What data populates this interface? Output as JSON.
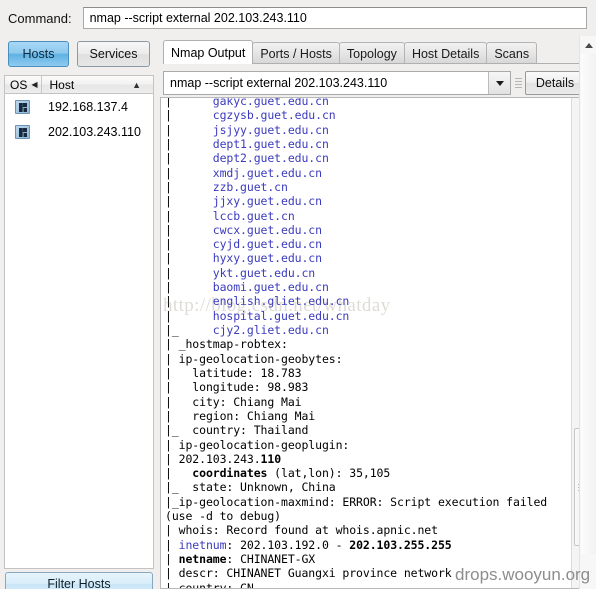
{
  "command_bar": {
    "label": "Command:",
    "value": "nmap --script external 202.103.243.110",
    "placeholder": "nmap"
  },
  "sidebar": {
    "buttons": [
      {
        "label": "Hosts",
        "active": true
      },
      {
        "label": "Services",
        "active": false
      }
    ],
    "column_headers": {
      "os": "OS",
      "host": "Host",
      "sort_indicator": "▲",
      "os_divider": "◀"
    },
    "hosts": [
      {
        "ip": "192.168.137.4",
        "os_icon": "windows-icon"
      },
      {
        "ip": "202.103.243.110",
        "os_icon": "windows-icon"
      }
    ],
    "filter_button": "Filter Hosts"
  },
  "tabs": [
    {
      "label": "Nmap Output",
      "active": true
    },
    {
      "label": "Ports / Hosts",
      "active": false
    },
    {
      "label": "Topology",
      "active": false
    },
    {
      "label": "Host Details",
      "active": false
    },
    {
      "label": "Scans",
      "active": false
    }
  ],
  "scan_selector": {
    "value": "nmap --script external 202.103.243.110",
    "dropdown_icon": "chevron-down-icon",
    "gripper_icon": "grip-icon"
  },
  "details_button": "Details",
  "output": {
    "lines": [
      [
        {
          "t": "|      ",
          "s": "plain"
        },
        {
          "t": "gakyc.guet.edu.cn",
          "s": "blue"
        }
      ],
      [
        {
          "t": "|      ",
          "s": "plain"
        },
        {
          "t": "cgzysb.guet.edu.cn",
          "s": "blue"
        }
      ],
      [
        {
          "t": "|      ",
          "s": "plain"
        },
        {
          "t": "jsjyy.guet.edu.cn",
          "s": "blue"
        }
      ],
      [
        {
          "t": "|      ",
          "s": "plain"
        },
        {
          "t": "dept1.guet.edu.cn",
          "s": "blue"
        }
      ],
      [
        {
          "t": "|      ",
          "s": "plain"
        },
        {
          "t": "dept2.guet.edu.cn",
          "s": "blue"
        }
      ],
      [
        {
          "t": "|      ",
          "s": "plain"
        },
        {
          "t": "xmdj.guet.edu.cn",
          "s": "blue"
        }
      ],
      [
        {
          "t": "|      ",
          "s": "plain"
        },
        {
          "t": "zzb.guet.cn",
          "s": "blue"
        }
      ],
      [
        {
          "t": "|      ",
          "s": "plain"
        },
        {
          "t": "jjxy.guet.edu.cn",
          "s": "blue"
        }
      ],
      [
        {
          "t": "|      ",
          "s": "plain"
        },
        {
          "t": "lccb.guet.cn",
          "s": "blue"
        }
      ],
      [
        {
          "t": "|      ",
          "s": "plain"
        },
        {
          "t": "cwcx.guet.edu.cn",
          "s": "blue"
        }
      ],
      [
        {
          "t": "|      ",
          "s": "plain"
        },
        {
          "t": "cyjd.guet.edu.cn",
          "s": "blue"
        }
      ],
      [
        {
          "t": "|      ",
          "s": "plain"
        },
        {
          "t": "hyxy.guet.edu.cn",
          "s": "blue"
        }
      ],
      [
        {
          "t": "|      ",
          "s": "plain"
        },
        {
          "t": "ykt.guet.edu.cn",
          "s": "blue"
        }
      ],
      [
        {
          "t": "|      ",
          "s": "plain"
        },
        {
          "t": "baomi.guet.edu.cn",
          "s": "blue"
        }
      ],
      [
        {
          "t": "|      ",
          "s": "plain"
        },
        {
          "t": "english.gliet.edu.cn",
          "s": "blue"
        }
      ],
      [
        {
          "t": "|      ",
          "s": "plain"
        },
        {
          "t": "hospital.guet.edu.cn",
          "s": "blue"
        }
      ],
      [
        {
          "t": "|_     ",
          "s": "plain"
        },
        {
          "t": "cjy2.gliet.edu.cn",
          "s": "blue"
        }
      ],
      [
        {
          "t": "| _hostmap-robtex:",
          "s": "plain"
        }
      ],
      [
        {
          "t": "| ip-geolocation-geobytes:",
          "s": "plain"
        }
      ],
      [
        {
          "t": "|   latitude: 18.783",
          "s": "plain"
        }
      ],
      [
        {
          "t": "|   longitude: 98.983",
          "s": "plain"
        }
      ],
      [
        {
          "t": "|   city: Chiang Mai",
          "s": "plain"
        }
      ],
      [
        {
          "t": "|   region: Chiang Mai",
          "s": "plain"
        }
      ],
      [
        {
          "t": "|_  country: Thailand",
          "s": "plain"
        }
      ],
      [
        {
          "t": "| ip-geolocation-geoplugin:",
          "s": "plain"
        }
      ],
      [
        {
          "t": "| ",
          "s": "plain"
        },
        {
          "t": "202.103.243.",
          "s": "plain"
        },
        {
          "t": "110",
          "s": "bold"
        }
      ],
      [
        {
          "t": "|   ",
          "s": "plain"
        },
        {
          "t": "coordinates",
          "s": "bold"
        },
        {
          "t": " (lat,lon): 35,105",
          "s": "plain"
        }
      ],
      [
        {
          "t": "|_  state: Unknown, China",
          "s": "plain"
        }
      ],
      [
        {
          "t": "|_ip-geolocation-maxmind: ERROR: Script execution failed",
          "s": "plain"
        }
      ],
      [
        {
          "t": "(use -d to debug)",
          "s": "plain"
        }
      ],
      [
        {
          "t": "| whois: Record found at whois.apnic.net",
          "s": "plain"
        }
      ],
      [
        {
          "t": "| ",
          "s": "plain"
        },
        {
          "t": "inetnum",
          "s": "blue"
        },
        {
          "t": ": 202.103.192.0 - ",
          "s": "plain"
        },
        {
          "t": "202.103.255.255",
          "s": "bold"
        }
      ],
      [
        {
          "t": "| ",
          "s": "plain"
        },
        {
          "t": "netname",
          "s": "bold"
        },
        {
          "t": ": CHINANET-GX",
          "s": "plain"
        }
      ],
      [
        {
          "t": "| descr: CHINANET Guangxi province network",
          "s": "plain"
        }
      ],
      [
        {
          "t": "| country: CN",
          "s": "plain"
        }
      ]
    ],
    "scrollbar": {
      "thumb_icon": "grip-icon"
    }
  },
  "watermarks": {
    "csdn": "http://blog.csdn.net/whatday",
    "drops": "drops.wooyun.org"
  },
  "colors": {
    "accent_blue": "#3b3bbf",
    "active_tab_blue": "#60b1e4",
    "console_bg": "#ffffff",
    "window_bg": "#f0efee"
  }
}
